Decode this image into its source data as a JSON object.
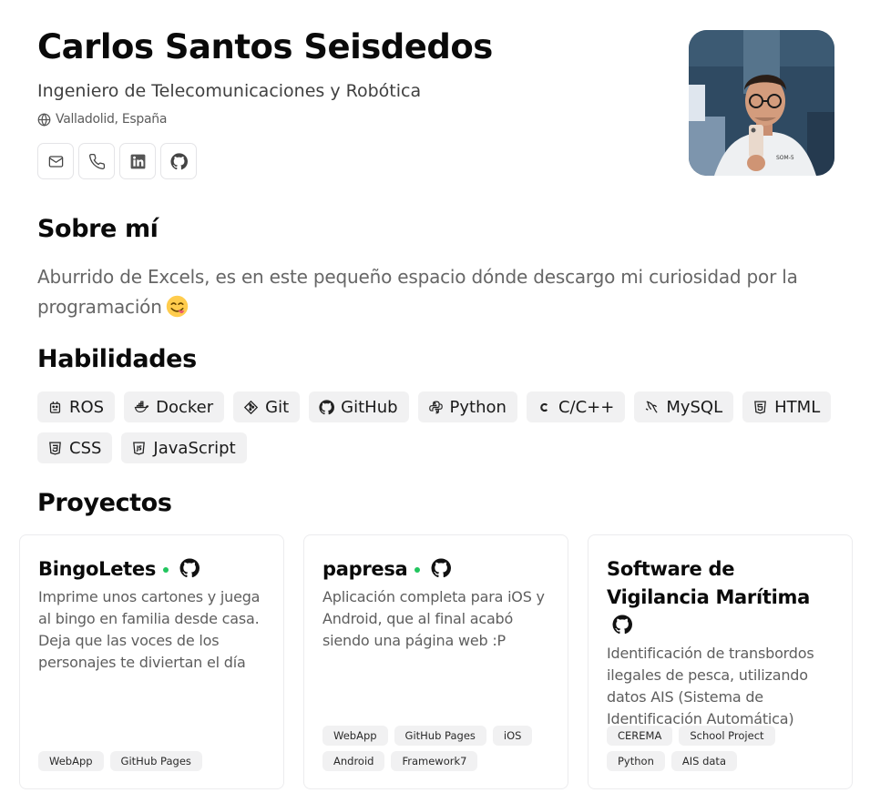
{
  "header": {
    "name": "Carlos Santos Seisdedos",
    "role": "Ingeniero de Telecomunicaciones y Robótica",
    "location": "Valladolid, España",
    "contacts": [
      {
        "icon": "mail-icon"
      },
      {
        "icon": "phone-icon"
      },
      {
        "icon": "linkedin-icon"
      },
      {
        "icon": "github-icon"
      }
    ]
  },
  "about": {
    "title": "Sobre mí",
    "text": "Aburrido de Excels, es en este pequeño espacio dónde descargo mi curiosidad por la programación",
    "emoji": "face-savoring-food-emoji"
  },
  "skills": {
    "title": "Habilidades",
    "items": [
      {
        "label": "ROS",
        "icon": "robot-icon"
      },
      {
        "label": "Docker",
        "icon": "docker-icon"
      },
      {
        "label": "Git",
        "icon": "git-icon"
      },
      {
        "label": "GitHub",
        "icon": "github-icon"
      },
      {
        "label": "Python",
        "icon": "python-icon"
      },
      {
        "label": "C/C++",
        "icon": "c-icon"
      },
      {
        "label": "MySQL",
        "icon": "mysql-icon"
      },
      {
        "label": "HTML",
        "icon": "html5-icon"
      },
      {
        "label": "CSS",
        "icon": "css3-icon"
      },
      {
        "label": "JavaScript",
        "icon": "javascript-icon"
      }
    ]
  },
  "projects": {
    "title": "Proyectos",
    "items": [
      {
        "title": "BingoLetes",
        "live": true,
        "description": "Imprime unos cartones y juega al bingo en familia desde casa. Deja que las voces de los personajes te diviertan el día",
        "tags": [
          "WebApp",
          "GitHub Pages"
        ]
      },
      {
        "title": "papresa",
        "live": true,
        "description": "Aplicación completa para iOS y Android, que al final acabó siendo una página web :P",
        "tags": [
          "WebApp",
          "GitHub Pages",
          "iOS",
          "Android",
          "Framework7"
        ]
      },
      {
        "title": "Software de Vigilancia Marítima",
        "live": false,
        "description": "Identificación de transbordos ilegales de pesca, utilizando datos AIS (Sistema de Identificación Automática)",
        "tags": [
          "CEREMA",
          "School Project",
          "Python",
          "AIS data"
        ]
      }
    ]
  },
  "colors": {
    "live_dot": "#22c55e",
    "chip_bg": "#f1f1f2",
    "muted_text": "#666666"
  }
}
